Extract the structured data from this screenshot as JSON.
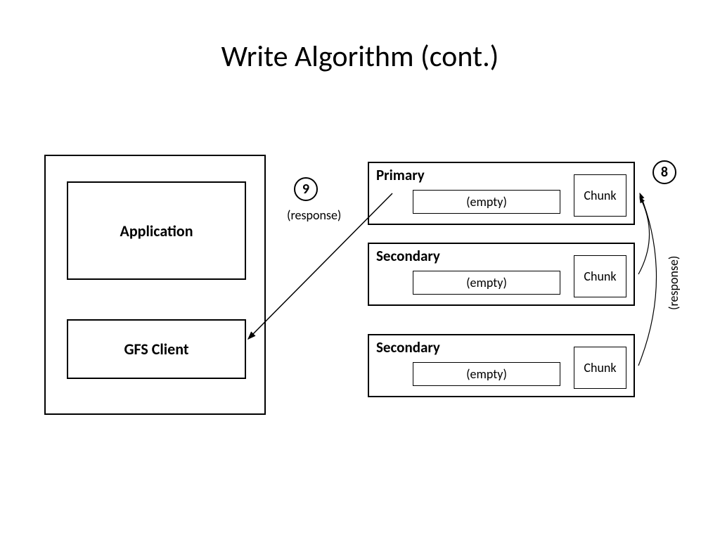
{
  "title": "Write Algorithm (cont.)",
  "left": {
    "application": "Application",
    "gfs_client": "GFS Client"
  },
  "steps": {
    "nine": "9",
    "eight": "8",
    "response_9": "(response)",
    "response_8": "(response)"
  },
  "servers": [
    {
      "label": "Primary",
      "buffer": "(empty)",
      "chunk": "Chunk"
    },
    {
      "label": "Secondary",
      "buffer": "(empty)",
      "chunk": "Chunk"
    },
    {
      "label": "Secondary",
      "buffer": "(empty)",
      "chunk": "Chunk"
    }
  ]
}
